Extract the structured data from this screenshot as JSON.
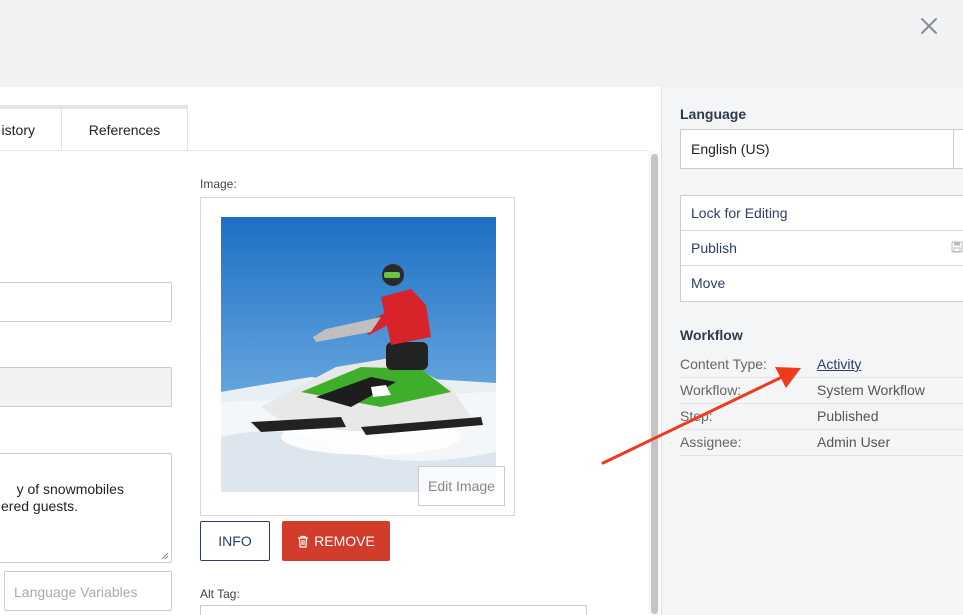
{
  "tabs": [
    {
      "label": "istory"
    },
    {
      "label": "References"
    }
  ],
  "form": {
    "description_text": "y of snowmobiles\nered guests.",
    "language_variables_placeholder": "Language Variables",
    "image_label": "Image:",
    "edit_image_label": "Edit Image",
    "info_label": "INFO",
    "remove_label": "REMOVE",
    "alt_tag_label": "Alt Tag:"
  },
  "sidebar": {
    "language_heading": "Language",
    "language_value": "English (US)",
    "actions": [
      {
        "label": "Lock for Editing"
      },
      {
        "label": "Publish"
      },
      {
        "label": "Move"
      }
    ],
    "workflow_heading": "Workflow",
    "workflow_rows": [
      {
        "key": "Content Type:",
        "value": "Activity"
      },
      {
        "key": "Workflow:",
        "value": "System Workflow"
      },
      {
        "key": "Step:",
        "value": "Published"
      },
      {
        "key": "Assignee:",
        "value": "Admin User"
      }
    ]
  },
  "colors": {
    "primary_navy": "#2d3e62",
    "danger_red": "#d23c2a",
    "annotation_arrow": "#f03a1e",
    "topbar_bg": "#f1f2f4"
  },
  "icons": [
    "close-icon",
    "trash-icon",
    "caret-down-icon",
    "save-icon",
    "resize-grip-icon"
  ]
}
